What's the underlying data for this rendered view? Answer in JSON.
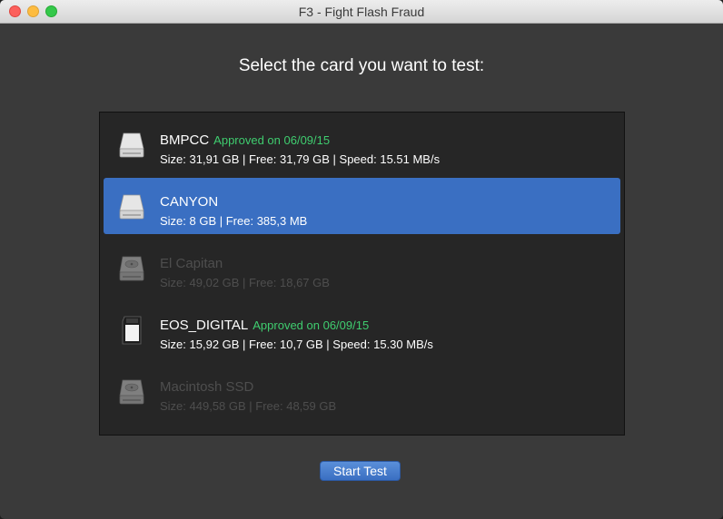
{
  "window": {
    "title": "F3 - Fight Flash Fraud"
  },
  "heading": "Select the card you want to test:",
  "drives": [
    {
      "name": "BMPCC",
      "status": "Approved on 06/09/15",
      "details": "Size: 31,91 GB | Free: 31,79 GB | Speed: 15.51 MB/s",
      "icon": "removable-drive-icon",
      "state": "normal"
    },
    {
      "name": "CANYON",
      "status": "",
      "details": "Size: 8 GB | Free: 385,3 MB",
      "icon": "removable-drive-icon",
      "state": "selected"
    },
    {
      "name": "El Capitan",
      "status": "",
      "details": "Size: 49,02 GB | Free: 18,67 GB",
      "icon": "internal-hard-drive-icon",
      "state": "disabled"
    },
    {
      "name": "EOS_DIGITAL",
      "status": "Approved on 06/09/15",
      "details": "Size: 15,92 GB | Free: 10,7 GB | Speed: 15.30 MB/s",
      "icon": "sd-card-icon",
      "state": "normal"
    },
    {
      "name": "Macintosh SSD",
      "status": "",
      "details": "Size: 449,58 GB | Free: 48,59 GB",
      "icon": "internal-hard-drive-icon",
      "state": "disabled"
    }
  ],
  "start_button": {
    "label": "Start Test"
  },
  "colors": {
    "selection": "#3a6fc2",
    "approved": "#3fcd6f",
    "background": "#3a3a3a",
    "list_background": "#262626"
  }
}
